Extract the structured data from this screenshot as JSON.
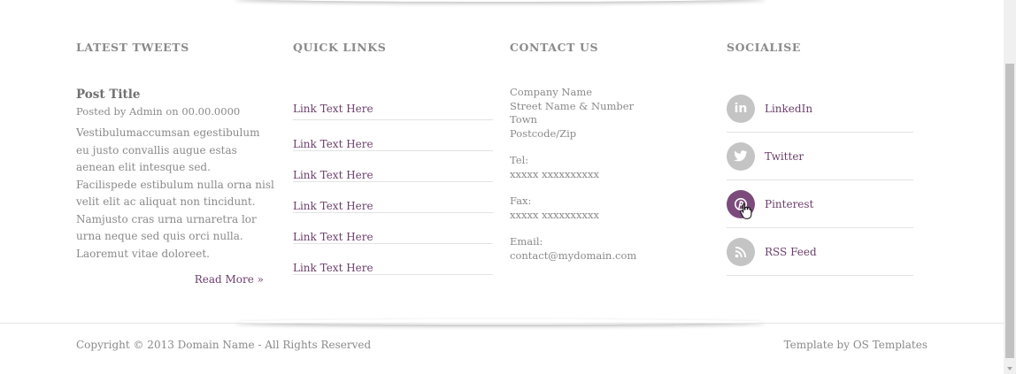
{
  "tweets": {
    "heading": "LATEST TWEETS",
    "post_title": "Post Title",
    "post_meta": "Posted by Admin on 00.00.0000",
    "post_body": "Vestibulumaccumsan egestibulum eu justo convallis augue estas aenean elit intesque sed. Facilispede estibulum nulla orna nisl velit elit ac aliquat non tincidunt. Namjusto cras urna urnaretra lor urna neque sed quis orci nulla. Laoremut vitae doloreet.",
    "read_more": "Read More »"
  },
  "quick_links": {
    "heading": "QUICK LINKS",
    "items": [
      "Link Text Here",
      "Link Text Here",
      "Link Text Here",
      "Link Text Here",
      "Link Text Here",
      "Link Text Here"
    ]
  },
  "contact": {
    "heading": "CONTACT US",
    "address": [
      "Company Name",
      "Street Name & Number",
      "Town",
      "Postcode/Zip"
    ],
    "tel_label": "Tel:",
    "tel_value": "xxxxx xxxxxxxxxx",
    "fax_label": "Fax:",
    "fax_value": "xxxxx xxxxxxxxxx",
    "email_label": "Email:",
    "email_value": "contact@mydomain.com"
  },
  "social": {
    "heading": "SOCIALISE",
    "items": [
      {
        "label": "LinkedIn",
        "icon": "linkedin-icon",
        "glyph": "in"
      },
      {
        "label": "Twitter",
        "icon": "twitter-icon",
        "glyph": "🐦"
      },
      {
        "label": "Pinterest",
        "icon": "pinterest-icon",
        "glyph": "℗"
      },
      {
        "label": "RSS Feed",
        "icon": "rss-icon",
        "glyph": "◝"
      }
    ],
    "active_color": "#7b4b7b",
    "inactive_color": "#c4c4c4"
  },
  "footer": {
    "copyright": "Copyright © 2013 Domain Name - All Rights Reserved",
    "credit": "Template by OS Templates"
  },
  "colors": {
    "link": "#6b3f6b",
    "text": "#8a8a8a"
  }
}
